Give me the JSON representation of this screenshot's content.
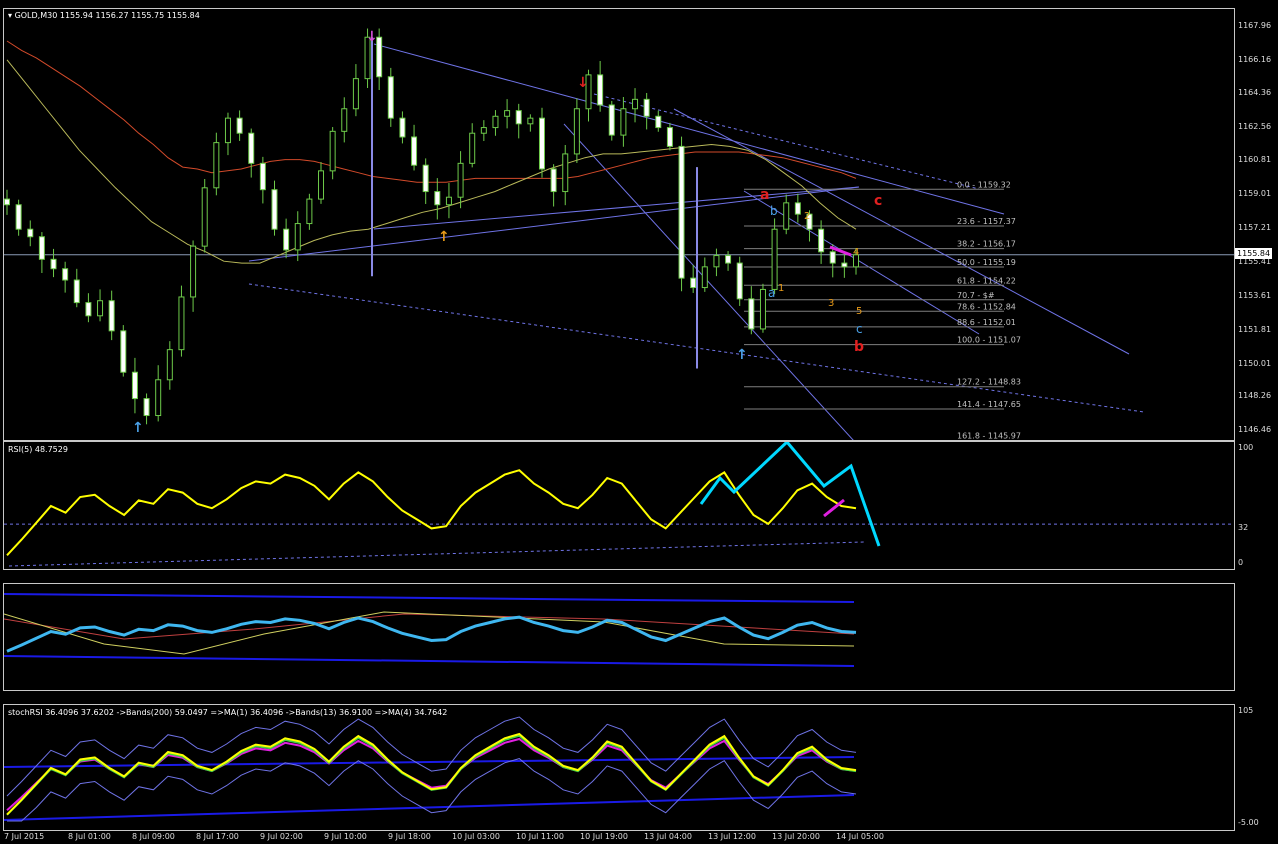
{
  "chart_data": [
    {
      "type": "candlestick",
      "title": "GOLD,M30",
      "quote": [
        "1155.94",
        "1156.27",
        "1155.75",
        "1155.84"
      ],
      "last_price": "1155.84",
      "yticks": [
        "1167.96",
        "1166.16",
        "1164.36",
        "1162.56",
        "1160.81",
        "1159.01",
        "1157.21",
        "1155.41",
        "1153.61",
        "1151.81",
        "1150.01",
        "1148.26",
        "1146.46"
      ],
      "ylim": [
        1146.0,
        1168.9
      ],
      "fib_levels": [
        {
          "ratio": "0.0",
          "price": "1159.32"
        },
        {
          "ratio": "23.6",
          "price": "1157.37"
        },
        {
          "ratio": "38.2",
          "price": "1156.17"
        },
        {
          "ratio": "50.0",
          "price": "1155.19"
        },
        {
          "ratio": "61.8",
          "price": "1154.22"
        },
        {
          "ratio": "70.7",
          "price": "$#"
        },
        {
          "ratio": "78.6",
          "price": "1152.84"
        },
        {
          "ratio": "88.6",
          "price": "1152.01"
        },
        {
          "ratio": "100.0",
          "price": "1151.07"
        },
        {
          "ratio": "127.2",
          "price": "1148.83"
        },
        {
          "ratio": "141.4",
          "price": "1147.65"
        },
        {
          "ratio": "161.8",
          "price": "1145.97"
        }
      ],
      "wave_labels": [
        "a",
        "b",
        "c",
        "1",
        "2",
        "3",
        "4",
        "5",
        "a",
        "b",
        "c"
      ],
      "x_labels": [
        "7 Jul 2015",
        "8 Jul 01:00",
        "8 Jul 09:00",
        "8 Jul 17:00",
        "9 Jul 02:00",
        "9 Jul 10:00",
        "9 Jul 18:00",
        "10 Jul 03:00",
        "10 Jul 11:00",
        "10 Jul 19:00",
        "13 Jul 04:00",
        "13 Jul 12:00",
        "13 Jul 20:00",
        "14 Jul 05:00"
      ],
      "close_series": [
        1158.5,
        1157.2,
        1156.8,
        1155.6,
        1155.1,
        1154.5,
        1153.3,
        1152.6,
        1153.4,
        1151.8,
        1149.6,
        1148.2,
        1147.3,
        1149.2,
        1150.8,
        1153.6,
        1156.3,
        1159.4,
        1161.8,
        1163.1,
        1162.3,
        1160.7,
        1159.3,
        1157.2,
        1156.1,
        1157.5,
        1158.8,
        1160.3,
        1162.4,
        1163.6,
        1165.2,
        1167.4,
        1165.3,
        1163.1,
        1162.1,
        1160.6,
        1159.2,
        1158.5,
        1158.9,
        1160.7,
        1162.3,
        1162.6,
        1163.2,
        1163.5,
        1162.8,
        1163.1,
        1160.4,
        1159.2,
        1161.2,
        1163.6,
        1165.4,
        1163.8,
        1162.2,
        1163.6,
        1164.1,
        1163.2,
        1162.6,
        1161.6,
        1154.6,
        1154.1,
        1155.2,
        1155.8,
        1155.4,
        1153.5,
        1151.9,
        1154.0,
        1157.2,
        1158.6,
        1158.0,
        1157.2,
        1156.0,
        1155.4,
        1155.2,
        1155.84
      ],
      "ma_slow": [
        1167.2,
        1166.7,
        1166.3,
        1165.8,
        1165.3,
        1164.8,
        1164.2,
        1163.6,
        1163.0,
        1162.3,
        1161.7,
        1161.0,
        1160.5,
        1160.4,
        1160.2,
        1160.3,
        1160.4,
        1160.6,
        1160.8,
        1160.9,
        1160.9,
        1160.8,
        1160.6,
        1160.4,
        1160.2,
        1160.0,
        1159.9,
        1159.8,
        1159.7,
        1159.7,
        1159.7,
        1159.8,
        1159.9,
        1159.9,
        1159.9,
        1159.9,
        1159.9,
        1159.9,
        1159.9,
        1160.0,
        1160.2,
        1160.4,
        1160.6,
        1160.8,
        1161.0,
        1161.1,
        1161.2,
        1161.3,
        1161.3,
        1161.3,
        1161.3,
        1161.2,
        1161.1,
        1161.0,
        1160.8,
        1160.6,
        1160.4,
        1160.2,
        1159.9
      ],
      "ma_mid": [
        1166.2,
        1165.0,
        1163.8,
        1162.6,
        1161.4,
        1160.4,
        1159.4,
        1158.5,
        1157.6,
        1157.0,
        1156.4,
        1156.0,
        1155.5,
        1155.4,
        1155.4,
        1155.8,
        1156.2,
        1156.6,
        1156.9,
        1157.1,
        1157.2,
        1157.5,
        1157.8,
        1158.1,
        1158.3,
        1158.6,
        1158.9,
        1159.2,
        1159.6,
        1160.0,
        1160.4,
        1160.7,
        1161.0,
        1161.2,
        1161.2,
        1161.3,
        1161.4,
        1161.5,
        1161.6,
        1161.7,
        1161.6,
        1161.4,
        1160.9,
        1160.2,
        1159.5,
        1158.6,
        1157.8,
        1157.2
      ],
      "rsi": {
        "label": "RSI(5) 48.7529",
        "levels": [
          "100",
          "32",
          "0"
        ],
        "values": [
          6,
          20,
          35,
          50,
          44,
          58,
          60,
          50,
          42,
          55,
          52,
          65,
          62,
          52,
          48,
          56,
          66,
          72,
          70,
          78,
          75,
          68,
          56,
          70,
          80,
          72,
          58,
          46,
          38,
          30,
          32,
          50,
          62,
          70,
          78,
          82,
          70,
          62,
          52,
          48,
          60,
          75,
          70,
          54,
          38,
          30,
          44,
          58,
          72,
          80,
          60,
          42,
          34,
          48,
          64,
          70,
          58,
          50,
          48
        ]
      },
      "stoch_label": "stochRSI 36.4096 37.6202 ->Bands(200) 59.0497 =>MA(1) 36.4096 ->Bands(13) 36.9100 =>MA(4) 34.7642",
      "stoch_levels": [
        "105",
        "-5.00"
      ]
    }
  ]
}
